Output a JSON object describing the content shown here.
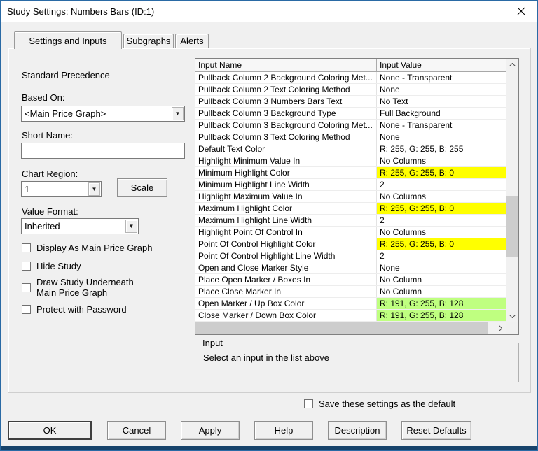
{
  "window": {
    "title": "Study Settings: Numbers Bars (ID:1)"
  },
  "tabs": [
    {
      "label": "Settings and Inputs",
      "active": true
    },
    {
      "label": "Subgraphs",
      "active": false
    },
    {
      "label": "Alerts",
      "active": false
    }
  ],
  "left_panel": {
    "precedence_label": "Standard Precedence",
    "based_on_label": "Based On:",
    "based_on_value": "<Main Price Graph>",
    "short_name_label": "Short Name:",
    "short_name_value": "",
    "chart_region_label": "Chart Region:",
    "chart_region_value": "1",
    "scale_button_label": "Scale",
    "value_format_label": "Value Format:",
    "value_format_value": "Inherited",
    "checkboxes": [
      {
        "label": "Display As Main Price Graph",
        "checked": false
      },
      {
        "label": "Hide Study",
        "checked": false
      },
      {
        "label": "Draw Study Underneath Main Price Graph",
        "checked": false
      },
      {
        "label": "Protect with Password",
        "checked": false
      }
    ]
  },
  "inputs_table": {
    "columns": [
      "Input Name",
      "Input Value"
    ],
    "rows": [
      {
        "name": "Pullback Column 2 Background Coloring Met...",
        "value": "None - Transparent",
        "value_bg": null
      },
      {
        "name": "Pullback Column 2 Text Coloring Method",
        "value": "None",
        "value_bg": null
      },
      {
        "name": "Pullback Column 3 Numbers Bars Text",
        "value": "No Text",
        "value_bg": null
      },
      {
        "name": "Pullback Column 3 Background Type",
        "value": "Full Background",
        "value_bg": null
      },
      {
        "name": "Pullback Column 3 Background Coloring Met...",
        "value": "None - Transparent",
        "value_bg": null
      },
      {
        "name": "Pullback Column 3 Text Coloring Method",
        "value": "None",
        "value_bg": null
      },
      {
        "name": "Default Text Color",
        "value": "R: 255, G: 255, B: 255",
        "value_bg": null
      },
      {
        "name": "Highlight Minimum Value In",
        "value": "No Columns",
        "value_bg": null
      },
      {
        "name": "Minimum Highlight Color",
        "value": "R: 255, G: 255, B: 0",
        "value_bg": "#ffff00"
      },
      {
        "name": "Minimum Highlight Line Width",
        "value": "2",
        "value_bg": null
      },
      {
        "name": "Highlight Maximum Value In",
        "value": "No Columns",
        "value_bg": null
      },
      {
        "name": "Maximum Highlight Color",
        "value": "R: 255, G: 255, B: 0",
        "value_bg": "#ffff00"
      },
      {
        "name": "Maximum Highlight Line Width",
        "value": "2",
        "value_bg": null
      },
      {
        "name": "Highlight Point Of Control In",
        "value": "No Columns",
        "value_bg": null
      },
      {
        "name": "Point Of Control Highlight Color",
        "value": "R: 255, G: 255, B: 0",
        "value_bg": "#ffff00"
      },
      {
        "name": "Point Of Control Highlight Line Width",
        "value": "2",
        "value_bg": null
      },
      {
        "name": "Open and Close Marker Style",
        "value": "None",
        "value_bg": null
      },
      {
        "name": "Place Open Marker / Boxes In",
        "value": "No Column",
        "value_bg": null
      },
      {
        "name": "Place Close Marker In",
        "value": "No Column",
        "value_bg": null
      },
      {
        "name": "Open Marker / Up Box Color",
        "value": "R: 191, G: 255, B: 128",
        "value_bg": "#bfff80"
      },
      {
        "name": "Close Marker / Down Box Color",
        "value": "R: 191, G: 255, B: 128",
        "value_bg": "#bfff80"
      }
    ]
  },
  "input_group": {
    "title": "Input",
    "message": "Select an input in the list above"
  },
  "save_default": {
    "label": "Save these settings as the default",
    "checked": false
  },
  "buttons": [
    "OK",
    "Cancel",
    "Apply",
    "Help",
    "Description",
    "Reset Defaults"
  ],
  "colors": {
    "highlight_yellow": "#ffff00",
    "highlight_green": "#bfff80",
    "accent_border": "#2a6aa5",
    "dialog_background": "#f0f0f0"
  }
}
